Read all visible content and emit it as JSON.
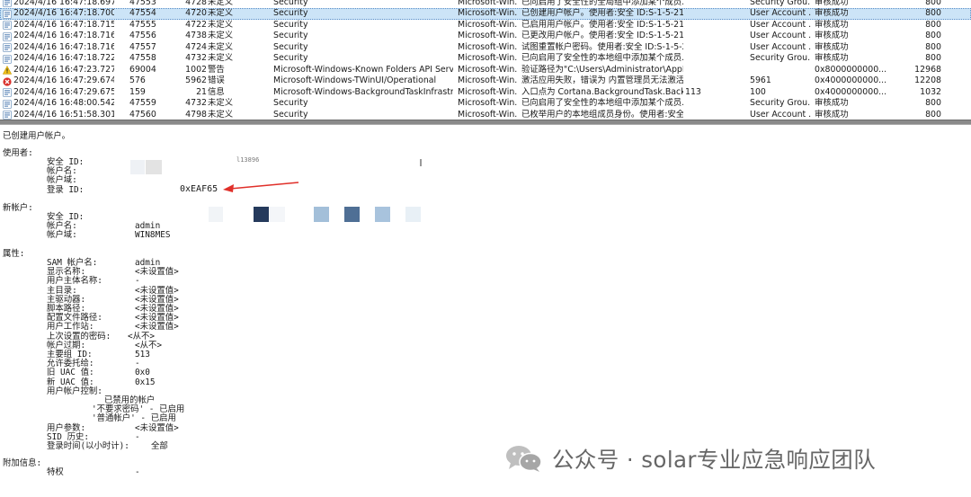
{
  "event_list": {
    "rows": [
      {
        "level_icon": "info-icon",
        "time": "2024/4/16 16:47:18.697",
        "record": "47553",
        "id": "4728",
        "level": "未定义",
        "source": "Security",
        "computer": "Microsoft-Win...",
        "message": "已向启用了安全性的全局组中添加某个成员...",
        "version": "",
        "group": "Security Grou...",
        "keywords": "审核成功",
        "event": "800",
        "clipped": true
      },
      {
        "level_icon": "info-icon",
        "time": "2024/4/16 16:47:18.700",
        "record": "47554",
        "id": "4720",
        "level": "未定义",
        "source": "Security",
        "computer": "Microsoft-Win...",
        "message": "已创建用户帐户。使用者:安全 ID:S-1-5-21-...",
        "version": "",
        "group": "User Account ...",
        "keywords": "审核成功",
        "event": "800",
        "selected": true
      },
      {
        "level_icon": "info-icon",
        "time": "2024/4/16 16:47:18.715",
        "record": "47555",
        "id": "4722",
        "level": "未定义",
        "source": "Security",
        "computer": "Microsoft-Win...",
        "message": "已启用用户帐户。使用者:安全 ID:S-1-5-21-...",
        "version": "",
        "group": "User Account ...",
        "keywords": "审核成功",
        "event": "800"
      },
      {
        "level_icon": "info-icon",
        "time": "2024/4/16 16:47:18.716",
        "record": "47556",
        "id": "4738",
        "level": "未定义",
        "source": "Security",
        "computer": "Microsoft-Win...",
        "message": "已更改用户帐户。使用者:安全 ID:S-1-5-21-...",
        "version": "",
        "group": "User Account ...",
        "keywords": "审核成功",
        "event": "800"
      },
      {
        "level_icon": "info-icon",
        "time": "2024/4/16 16:47:18.716",
        "record": "47557",
        "id": "4724",
        "level": "未定义",
        "source": "Security",
        "computer": "Microsoft-Win...",
        "message": "试图重置帐户密码。使用者:安全 ID:S-1-5-2...",
        "version": "",
        "group": "User Account ...",
        "keywords": "审核成功",
        "event": "800"
      },
      {
        "level_icon": "info-icon",
        "time": "2024/4/16 16:47:18.722",
        "record": "47558",
        "id": "4732",
        "level": "未定义",
        "source": "Security",
        "computer": "Microsoft-Win...",
        "message": "已向启用了安全性的本地组中添加某个成员...",
        "version": "",
        "group": "Security Grou...",
        "keywords": "审核成功",
        "event": "800"
      },
      {
        "level_icon": "warning-icon",
        "time": "2024/4/16 16:47:23.727",
        "record": "69004",
        "id": "1002",
        "level": "警告",
        "source": "Microsoft-Windows-Known Folders API Service",
        "computer": "Microsoft-Win...",
        "message": "验证路径为\"C:\\Users\\Administrator\\AppD...",
        "version": "",
        "group": "",
        "keywords": "0x8000000000...",
        "event": "12968"
      },
      {
        "level_icon": "error-icon",
        "time": "2024/4/16 16:47:29.674",
        "record": "576",
        "id": "5962",
        "level": "错误",
        "source": "Microsoft-Windows-TWinUI/Operational",
        "computer": "Microsoft-Win...",
        "message": "激活应用失败，错误为 内置管理员无法激活...",
        "version": "",
        "group": "5961",
        "keywords": "0x4000000000...",
        "event": "12208"
      },
      {
        "level_icon": "info-icon",
        "time": "2024/4/16 16:47:29.675",
        "record": "159",
        "id": "21",
        "level": "信息",
        "source": "Microsoft-Windows-BackgroundTaskInfrastruc...",
        "computer": "Microsoft-Win...",
        "message": "入口点为 Cortana.BackgroundTask.Backgr...",
        "version": "113",
        "group": "100",
        "keywords": "0x4000000000...",
        "event": "1032"
      },
      {
        "level_icon": "info-icon",
        "time": "2024/4/16 16:48:00.542",
        "record": "47559",
        "id": "4732",
        "level": "未定义",
        "source": "Security",
        "computer": "Microsoft-Win...",
        "message": "已向启用了安全性的本地组中添加某个成员...",
        "version": "",
        "group": "Security Grou...",
        "keywords": "审核成功",
        "event": "800"
      },
      {
        "level_icon": "info-icon",
        "time": "2024/4/16 16:51:58.301",
        "record": "47560",
        "id": "4798",
        "level": "未定义",
        "source": "Security",
        "computer": "Microsoft-Win...",
        "message": "已枚举用户的本地组成员身份。使用者:安全...",
        "version": "",
        "group": "User Account ...",
        "keywords": "审核成功",
        "event": "800",
        "clipped": true
      }
    ]
  },
  "detail": {
    "header": "已创建用户帐户。",
    "subject_heading": "使用者:",
    "subject": {
      "security_id_label": "安全 ID:",
      "security_id_value": "l13896",
      "account_name_label": "帐户名:",
      "account_domain_label": "帐户域:",
      "logon_id_label": "登录 ID:",
      "logon_id_value": "0xEAF65"
    },
    "new_account_heading": "新帐户:",
    "new_account": {
      "security_id_label": "安全 ID:",
      "account_name_label": "帐户名:",
      "account_name_value": "admin",
      "account_domain_label": "帐户域:",
      "account_domain_value": "WIN8MES"
    },
    "attributes_heading": "属性:",
    "attributes": [
      {
        "label": "SAM 帐户名:",
        "value": "admin"
      },
      {
        "label": "显示名称:",
        "value": "<未设置值>"
      },
      {
        "label": "用户主体名称:",
        "value": "-"
      },
      {
        "label": "主目录:",
        "value": "<未设置值>"
      },
      {
        "label": "主驱动器:",
        "value": "<未设置值>"
      },
      {
        "label": "脚本路径:",
        "value": "<未设置值>"
      },
      {
        "label": "配置文件路径:",
        "value": "<未设置值>"
      },
      {
        "label": "用户工作站:",
        "value": "<未设置值>"
      },
      {
        "label": "上次设置的密码:",
        "value": "<从不>"
      },
      {
        "label": "帐户过期:",
        "value": "<从不>"
      },
      {
        "label": "主要组 ID:",
        "value": "513"
      },
      {
        "label": "允许委托给:",
        "value": "-"
      },
      {
        "label": "旧 UAC 值:",
        "value": "0x0"
      },
      {
        "label": "新 UAC 值:",
        "value": "0x15"
      },
      {
        "label": "用户帐户控制:",
        "value": ""
      }
    ],
    "uac_flags": [
      "已禁用的帐户",
      "'不要求密码' - 已启用",
      "'普通帐户' - 已启用"
    ],
    "attributes_tail": [
      {
        "label": "用户参数:",
        "value": "<未设置值>"
      },
      {
        "label": "SID 历史:",
        "value": "-"
      },
      {
        "label": "登录时间(以小时计):",
        "value": "全部"
      }
    ],
    "additional_heading": "附加信息:",
    "additional": {
      "label": "特权",
      "value": "-"
    }
  },
  "watermark": {
    "text": "公众号 · solar专业应急响应团队",
    "icon": "wechat-icon"
  },
  "colors": {
    "selected_row": "#cce4f7",
    "arrow": "#e0302a",
    "redaction_dark": "#253a5c",
    "redaction_mid": "#4f6f95",
    "redaction_light": "#a8c3dd"
  }
}
